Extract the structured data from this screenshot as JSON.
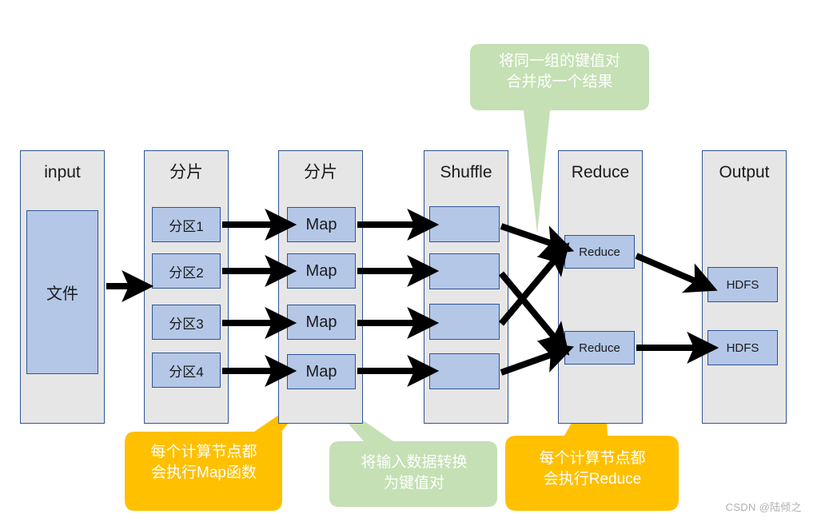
{
  "diagram": {
    "title": "MapReduce dataflow diagram",
    "colors": {
      "column_fill": "#e7e6e6",
      "column_border": "#2e5496",
      "node_fill": "#b4c7e7",
      "node_border": "#2e5496",
      "arrow": "#000000",
      "callout_green_fill": "#c5e0b4",
      "callout_orange_fill": "#ffc000",
      "callout_text": "#ffffff",
      "background": "#ffffff"
    },
    "columns": [
      {
        "id": "input",
        "label": "input",
        "nodes": [
          {
            "id": "file",
            "label": "文件"
          }
        ]
      },
      {
        "id": "split-1",
        "label": "分片",
        "nodes": [
          {
            "id": "partition-1",
            "label": "分区1"
          },
          {
            "id": "partition-2",
            "label": "分区2"
          },
          {
            "id": "partition-3",
            "label": "分区3"
          },
          {
            "id": "partition-4",
            "label": "分区4"
          }
        ]
      },
      {
        "id": "split-2",
        "label": "分片",
        "nodes": [
          {
            "id": "map-1",
            "label": "Map"
          },
          {
            "id": "map-2",
            "label": "Map"
          },
          {
            "id": "map-3",
            "label": "Map"
          },
          {
            "id": "map-4",
            "label": "Map"
          }
        ]
      },
      {
        "id": "shuffle",
        "label": "Shuffle",
        "nodes": [
          {
            "id": "shuffle-1",
            "label": ""
          },
          {
            "id": "shuffle-2",
            "label": ""
          },
          {
            "id": "shuffle-3",
            "label": ""
          },
          {
            "id": "shuffle-4",
            "label": ""
          }
        ]
      },
      {
        "id": "reduce",
        "label": "Reduce",
        "nodes": [
          {
            "id": "reduce-1",
            "label": "Reduce"
          },
          {
            "id": "reduce-2",
            "label": "Reduce"
          }
        ]
      },
      {
        "id": "output",
        "label": "Output",
        "nodes": [
          {
            "id": "hdfs-1",
            "label": "HDFS"
          },
          {
            "id": "hdfs-2",
            "label": "HDFS"
          }
        ]
      }
    ],
    "callouts": [
      {
        "id": "callout-merge",
        "style": "green",
        "text": "将同一组的键值对\n合并成一个结果"
      },
      {
        "id": "callout-map-node",
        "style": "orange",
        "text": "每个计算节点都\n会执行Map函数"
      },
      {
        "id": "callout-keyvalue",
        "style": "green",
        "text": "将输入数据转换\n为键值对"
      },
      {
        "id": "callout-reduce-node",
        "style": "orange",
        "text": "每个计算节点都\n会执行Reduce"
      }
    ],
    "watermark": "CSDN @陆倾之"
  }
}
